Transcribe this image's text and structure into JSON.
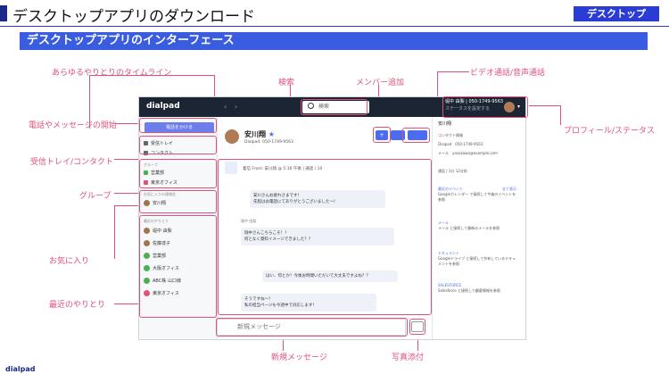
{
  "header": {
    "title": "デスクトップアプリのダウンロード",
    "badge": "デスクトップ"
  },
  "banner": {
    "title": "デスクトップアプリのインターフェース"
  },
  "labels": {
    "timeline": "あらゆるやりとりのタイムライン",
    "search": "検索",
    "add_member": "メンバー追加",
    "video_voice": "ビデオ通話/音声通話",
    "profile_status": "プロフィール/ステータス",
    "call_message": "電話やメッセージの開始",
    "inbox_contacts": "受信トレイ/コンタクト",
    "group": "グループ",
    "favorites": "お気に入り",
    "recent": "最近のやりとり",
    "new_message": "新規メッセージ",
    "attach_photo": "写真添付"
  },
  "app": {
    "logo": "dialpad",
    "search_placeholder": "検索",
    "profile_name": "堀中 由梨 | 050-1749-9563",
    "profile_status": "ステータスを設定する",
    "call_button": "電話をかける",
    "inbox": "受信トレイ",
    "contacts": "コンタクト",
    "groups_header": "グループ",
    "groups": [
      {
        "name": "営業部",
        "color": "#4caf50"
      },
      {
        "name": "東京オフィス",
        "color": "#e0527a"
      }
    ],
    "favorites_header": "お気に入りの連絡先",
    "favorites": [
      "安川翔"
    ],
    "recent_header": "最近のやりとり",
    "recent": [
      "堀中 由梨",
      "佐藤達子",
      "営業部",
      "大阪オフィス",
      "ABC株 山口様",
      "東京オフィス"
    ],
    "contact_name": "安川翔",
    "contact_number": "Dialpad: 050-1749-9563",
    "call_log": "着信 From: 安川翔 @ 5:16 午後 | 通話 / 10",
    "messages": [
      "安川さんお疲れさまです！",
      "先程はお電話にてありがとうございました〜！",
      "堀中さんこちらこそ！！",
      "何となく資料イメージできました？？",
      "はい、何とか！今後お時間いただいて大丈夫ですよね？？",
      "そうですね〜！",
      "私の担当ページも今週中で対応します！"
    ],
    "msg_sender": "堀中 由梨",
    "new_message_placeholder": "新規メッセージ",
    "right_panel": {
      "name": "安川翔",
      "info_header": "コンタクト情報",
      "dialpad_label": "Dialpad",
      "dialpad_value": "050-1749-9563",
      "email_label": "メール",
      "email_value": "yasukawa@example.com",
      "calls": "通話 | 1分 12分前",
      "event_header": "最近のイベント",
      "event_text": "Googleカレンダー で接続して今後のイベントを参照",
      "mail_header": "メール",
      "mail_text": "メール と接続して最新のメールを参照",
      "doc_header": "ドキュメント",
      "doc_text": "Googleドライブ と接続して共有しているドキュメントを参照",
      "sf_header": "SALESFORCE",
      "sf_text": "Salesforce と接続して顧客情報を参照",
      "link": "全て表示"
    }
  },
  "footer": {
    "logo": "dialpad"
  }
}
